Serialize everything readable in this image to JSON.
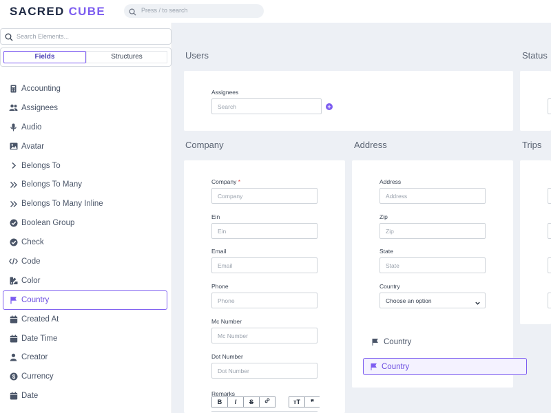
{
  "app": {
    "logo_part1": "SACRED ",
    "logo_part2": "CUBE",
    "search_placeholder": "Press / to search"
  },
  "colors": {
    "accent": "#7c5cf0",
    "background": "#edf0f5",
    "required": "#e53e3e"
  },
  "sidebar": {
    "search_placeholder": "Search Elements...",
    "tabs": {
      "fields": "Fields",
      "structures": "Structures"
    },
    "items": [
      {
        "label": "Accounting",
        "icon": "calculator-icon"
      },
      {
        "label": "Assignees",
        "icon": "users-icon"
      },
      {
        "label": "Audio",
        "icon": "microphone-icon"
      },
      {
        "label": "Avatar",
        "icon": "image-icon"
      },
      {
        "label": "Belongs To",
        "icon": "chevron-right-icon"
      },
      {
        "label": "Belongs To Many",
        "icon": "double-chevron-right-icon"
      },
      {
        "label": "Belongs To Many Inline",
        "icon": "double-chevron-right-icon"
      },
      {
        "label": "Boolean Group",
        "icon": "check-circle-icon"
      },
      {
        "label": "Check",
        "icon": "check-circle-icon"
      },
      {
        "label": "Code",
        "icon": "code-icon"
      },
      {
        "label": "Color",
        "icon": "palette-icon"
      },
      {
        "label": "Country",
        "icon": "flag-icon",
        "selected": true
      },
      {
        "label": "Created At",
        "icon": "calendar-icon"
      },
      {
        "label": "Date Time",
        "icon": "calendar-icon"
      },
      {
        "label": "Creator",
        "icon": "user-icon"
      },
      {
        "label": "Currency",
        "icon": "dollar-icon"
      },
      {
        "label": "Date",
        "icon": "calendar-icon"
      }
    ]
  },
  "sections": {
    "users": {
      "title": "Users",
      "assignees_label": "Assignees",
      "assignees_placeholder": "Search",
      "add_symbol": "+"
    },
    "status": {
      "title": "Status"
    },
    "company": {
      "title": "Company",
      "fields": [
        {
          "label": "Company",
          "placeholder": "Company",
          "required": "*"
        },
        {
          "label": "Ein",
          "placeholder": "Ein"
        },
        {
          "label": "Email",
          "placeholder": "Email"
        },
        {
          "label": "Phone",
          "placeholder": "Phone"
        },
        {
          "label": "Mc Number",
          "placeholder": "Mc Number"
        },
        {
          "label": "Dot Number",
          "placeholder": "Dot Number"
        }
      ],
      "remarks_label": "Remarks",
      "toolbar": {
        "bold": "B",
        "italic": "I",
        "strike": "S",
        "link": "🔗",
        "heading": "тТ",
        "quote": "❞"
      }
    },
    "address": {
      "title": "Address",
      "fields": [
        {
          "label": "Address",
          "placeholder": "Address"
        },
        {
          "label": "Zip",
          "placeholder": "Zip"
        },
        {
          "label": "State",
          "placeholder": "State"
        }
      ],
      "country_label": "Country",
      "country_select": "Choose an option",
      "dragged_item": "Country",
      "drop_target": "Country"
    },
    "trips": {
      "title": "Trips"
    }
  }
}
